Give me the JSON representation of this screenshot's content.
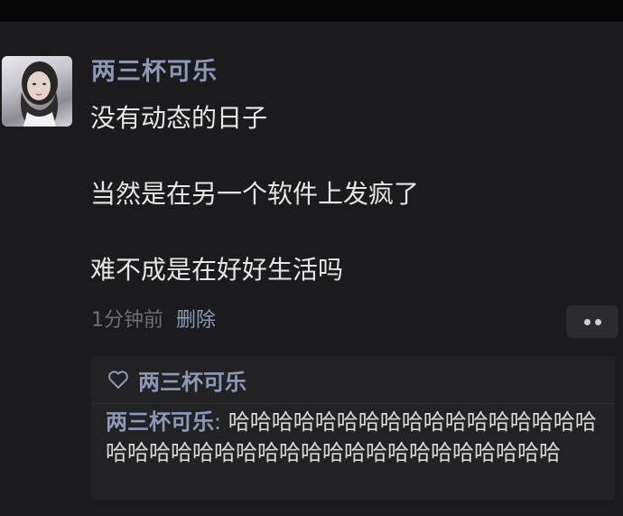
{
  "post": {
    "author": "两三杯可乐",
    "lines": [
      "没有动态的日子",
      "",
      "当然是在另一个软件上发疯了",
      "",
      "难不成是在好好生活吗"
    ],
    "time": "1分钟前",
    "delete_label": "删除",
    "more_icon": "more-dots-icon"
  },
  "likes": {
    "icon": "heart-outline-icon",
    "names": "两三杯可乐"
  },
  "comment": {
    "author": "两三杯可乐",
    "separator": ": ",
    "text": "哈哈哈哈哈哈哈哈哈哈哈哈哈哈哈哈哈哈哈哈哈哈哈哈哈哈哈哈哈哈哈哈哈哈哈哈哈哈"
  },
  "colors": {
    "background": "#1b1b1d",
    "name_link": "#8f98b6",
    "body_text": "#e6e6e6",
    "meta_text": "#6e6e72",
    "comment_bg": "#222224"
  }
}
